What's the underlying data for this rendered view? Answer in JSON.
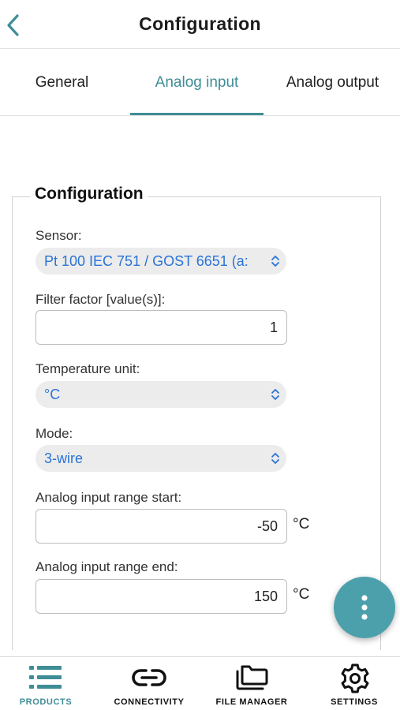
{
  "header": {
    "title": "Configuration",
    "back_icon": "chevron-left-icon"
  },
  "tabs": [
    {
      "label": "General",
      "active": false
    },
    {
      "label": "Analog input",
      "active": true
    },
    {
      "label": "Analog output",
      "active": false
    }
  ],
  "section": {
    "legend": "Configuration",
    "sensor": {
      "label": "Sensor:",
      "value": "Pt 100 IEC 751 / GOST 6651 (a:"
    },
    "filter_factor": {
      "label": "Filter factor [value(s)]:",
      "value": "1"
    },
    "temperature_unit": {
      "label": "Temperature unit:",
      "value": "°C"
    },
    "mode": {
      "label": "Mode:",
      "value": "3-wire"
    },
    "range_start": {
      "label": "Analog input range start:",
      "value": "-50",
      "unit": "°C"
    },
    "range_end": {
      "label": "Analog input range end:",
      "value": "150",
      "unit": "°C"
    }
  },
  "fab": {
    "icon": "more-vertical-icon"
  },
  "bottom_nav": [
    {
      "label": "PRODUCTS",
      "icon": "list-icon",
      "active": true
    },
    {
      "label": "CONNECTIVITY",
      "icon": "link-icon",
      "active": false
    },
    {
      "label": "FILE MANAGER",
      "icon": "folders-icon",
      "active": false
    },
    {
      "label": "SETTINGS",
      "icon": "gear-icon",
      "active": false
    }
  ],
  "colors": {
    "accent": "#3f8d97",
    "fab": "#4ba0ab",
    "select_text": "#2a74d6"
  }
}
